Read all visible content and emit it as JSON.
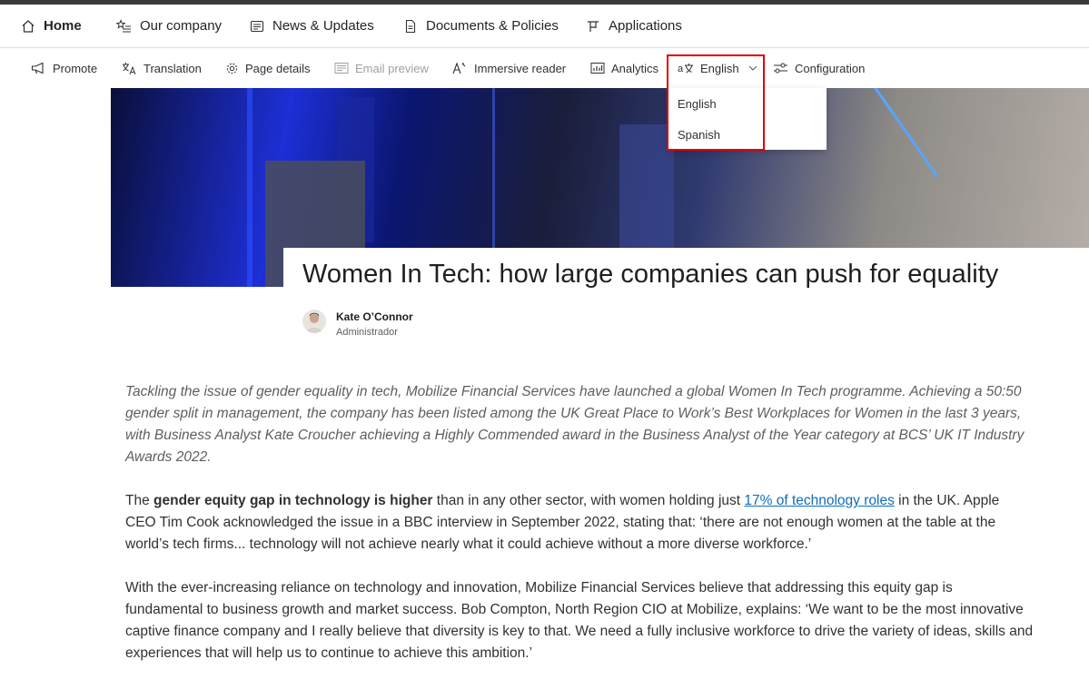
{
  "nav": {
    "home": "Home",
    "company": "Our company",
    "news": "News & Updates",
    "docs": "Documents & Policies",
    "apps": "Applications"
  },
  "commands": {
    "promote": "Promote",
    "translation": "Translation",
    "page_details": "Page details",
    "email_preview": "Email preview",
    "immersive_reader": "Immersive reader",
    "analytics": "Analytics",
    "language": "English",
    "configuration": "Configuration"
  },
  "language_menu": {
    "options": [
      "English",
      "Spanish"
    ]
  },
  "article": {
    "title": "Women In Tech: how large companies can push for equality",
    "author": "Kate O’Connor",
    "author_role": "Administrador",
    "intro": "Tackling the issue of gender equality in tech, Mobilize Financial Services have launched a global Women In Tech programme. Achieving a 50:50 gender split in management, the company has been listed among the UK Great Place to Work’s Best Workplaces for Women in the last 3 years, with Business Analyst Kate Croucher achieving a Highly Commended award in the Business Analyst of the Year category at BCS’ UK IT Industry Awards 2022.",
    "p1_pre": "The ",
    "p1_bold": "gender equity gap in technology is higher",
    "p1_mid": " than in any other sector, with women holding just ",
    "p1_link": "17% of technology roles",
    "p1_post": " in the UK. Apple CEO Tim Cook acknowledged the issue in a BBC interview in September 2022, stating that: ‘there are not enough women at the table at the world’s tech firms... technology will not achieve nearly what it could achieve without a more diverse workforce.’",
    "p2": "With the ever-increasing reliance on technology and innovation, Mobilize Financial Services believe that addressing this equity gap is fundamental to business growth and market success. Bob Compton, North Region CIO at Mobilize, explains: ‘We want to be the most innovative captive finance company and I really believe that diversity is key to that. We need a fully inclusive workforce to drive the variety of ideas, skills and experiences that will help us to continue to achieve this ambition.’"
  },
  "colors": {
    "link": "#0f6cbd",
    "highlight": "#e00000"
  }
}
